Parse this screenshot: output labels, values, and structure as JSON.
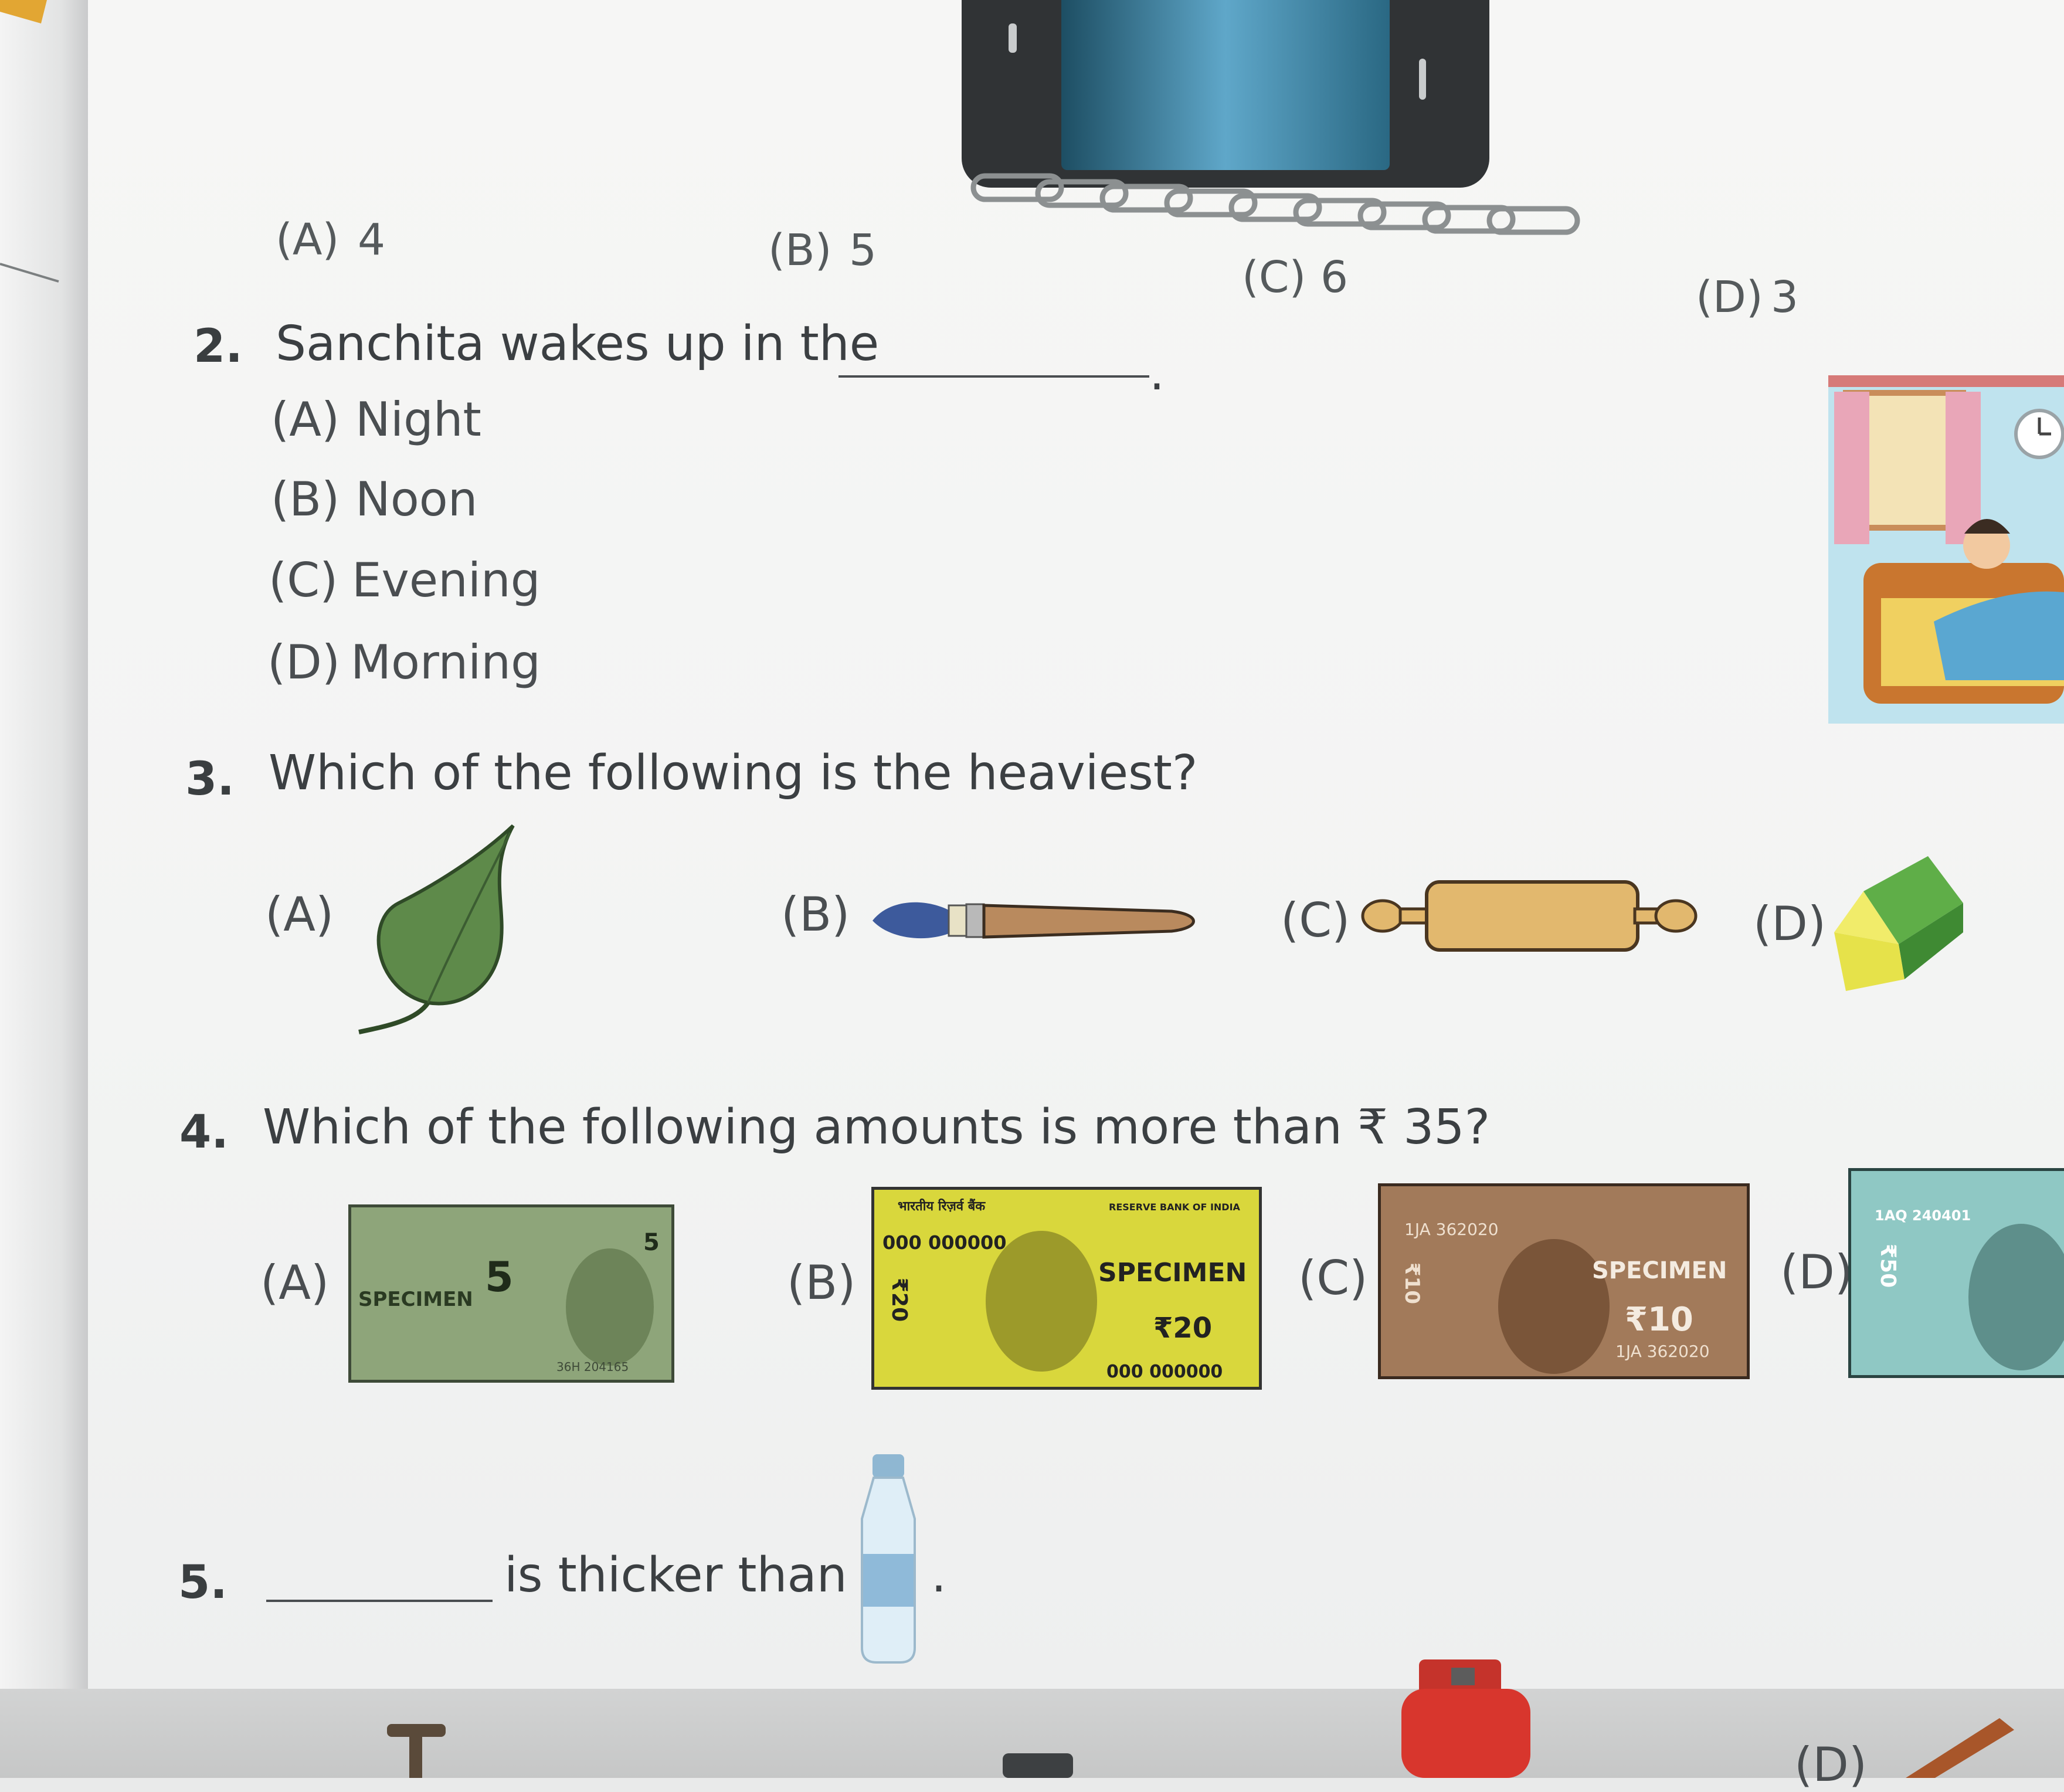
{
  "q1": {
    "options": [
      "(A)",
      "4",
      "(B)",
      "5",
      "(C)",
      "6",
      "(D)",
      "3"
    ]
  },
  "q2": {
    "number": "2.",
    "text": "Sanchita wakes up in the",
    "end": ".",
    "options": [
      "(A)",
      "Night",
      "(B)",
      "Noon",
      "(C)",
      "Evening",
      "(D)",
      "Morning"
    ]
  },
  "q3": {
    "number": "3.",
    "text": "Which of the following is the heaviest?",
    "labels": [
      "(A)",
      "(B)",
      "(C)",
      "(D)"
    ],
    "icons": [
      "leaf-icon",
      "paintbrush-icon",
      "rolling-pin-icon",
      "eraser-icon"
    ]
  },
  "q4": {
    "number": "4.",
    "text": "Which of the following amounts is more than ₹ 35?",
    "labels": [
      "(A)",
      "(B)",
      "(C)",
      "(D)"
    ],
    "notes": {
      "a": {
        "denomination": "5",
        "word": "SPECIMEN",
        "serial": "36H 204165",
        "color": "#7f9a6a"
      },
      "b": {
        "header": "भारतीय रिज़र्व बैंक",
        "header2": "RESERVE BANK OF INDIA",
        "serial_top": "000 000000",
        "serial_bottom": "000 000000",
        "denomination_side": "₹20",
        "word": "SPECIMEN",
        "amount": "₹20",
        "color": "#d9d73c"
      },
      "c": {
        "serial_top": "1JA 362020",
        "serial_bottom": "1JA 362020",
        "denomination_side": "₹10",
        "word": "SPECIMEN",
        "amount": "₹10",
        "color": "#a27a5a"
      },
      "d": {
        "serial_top": "1AQ 240401",
        "denomination_side": "₹50",
        "color": "#8fc8c4"
      }
    }
  },
  "q5": {
    "number": "5.",
    "text": "is thicker than",
    "end": "."
  },
  "bottom": {
    "partial_label": "(D)"
  },
  "colors": {
    "text": "#3b3f42",
    "leaf": "#5e8a4a",
    "brush_handle": "#b98a5e",
    "rolling_pin": "#e2b86e"
  }
}
